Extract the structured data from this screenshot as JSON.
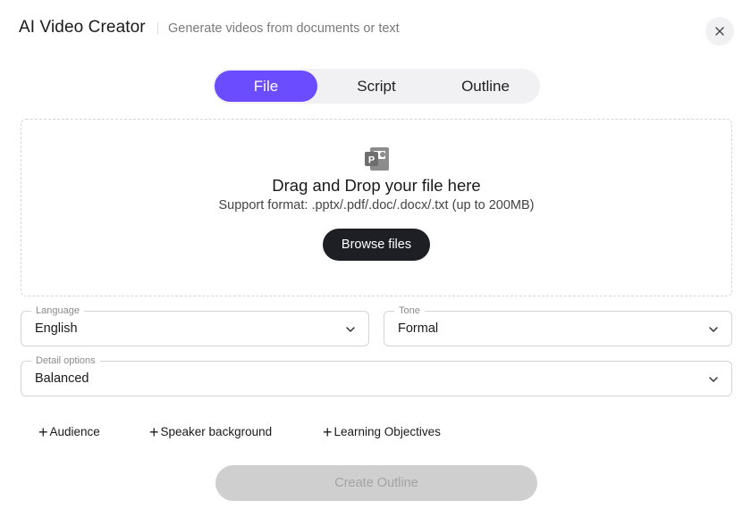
{
  "header": {
    "title": "AI Video Creator",
    "subtitle": "Generate videos from documents or text",
    "close_icon": "close-icon"
  },
  "tabs": [
    {
      "label": "File",
      "active": true
    },
    {
      "label": "Script",
      "active": false
    },
    {
      "label": "Outline",
      "active": false
    }
  ],
  "dropzone": {
    "icon": "powerpoint-file-icon",
    "title": "Drag and Drop your file here",
    "subtitle": "Support format: .pptx/.pdf/.doc/.docx/.txt (up to 200MB)",
    "browse_label": "Browse files"
  },
  "fields": {
    "language": {
      "label": "Language",
      "value": "English"
    },
    "tone": {
      "label": "Tone",
      "value": "Formal"
    },
    "detail": {
      "label": "Detail options",
      "value": "Balanced"
    }
  },
  "add_options": [
    {
      "label": "Audience"
    },
    {
      "label": "Speaker background"
    },
    {
      "label": "Learning Objectives"
    }
  ],
  "create_button": {
    "label": "Create Outline",
    "disabled": true
  },
  "colors": {
    "accent": "#6b4cff",
    "dark_button": "#1e1f24",
    "disabled_button": "#cfcfcf"
  }
}
